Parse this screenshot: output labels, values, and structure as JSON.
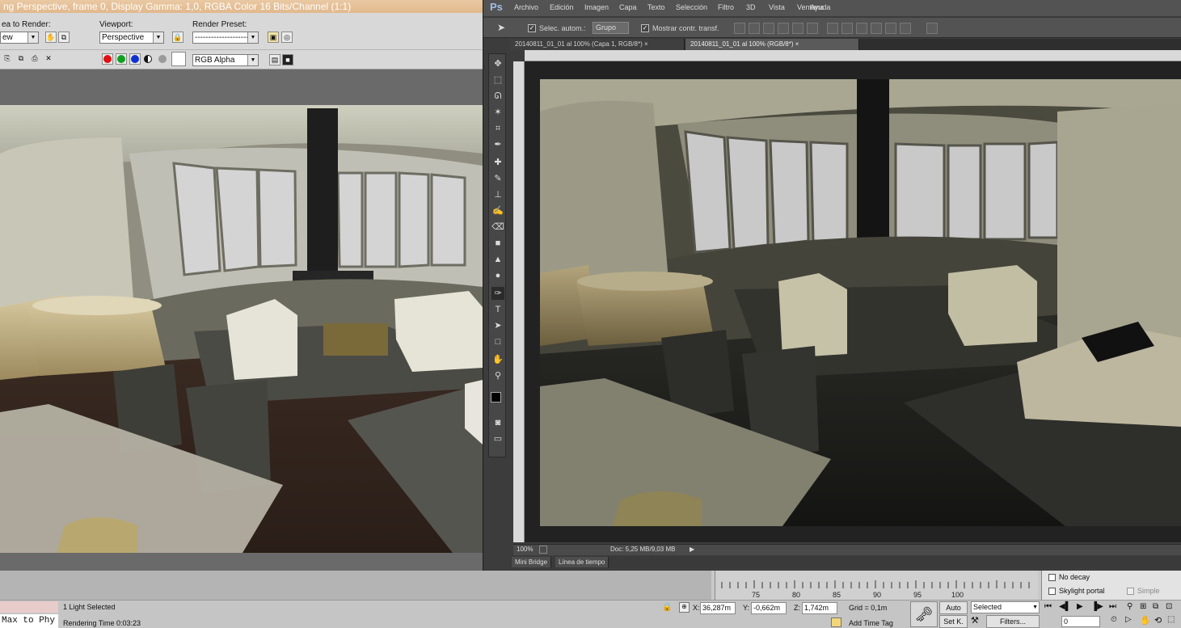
{
  "max": {
    "title": "ng Perspective, frame 0, Display Gamma: 1,0, RGBA Color 16 Bits/Channel (1:1)",
    "area_label": "ea to Render:",
    "area_value": "ew",
    "viewport_label": "Viewport:",
    "viewport_value": "Perspective",
    "preset_label": "Render Preset:",
    "preset_value": "--------------------",
    "channel_value": "RGB Alpha",
    "colors": {
      "red": "#e01010",
      "green": "#10a020",
      "blue": "#1030d0"
    }
  },
  "ps": {
    "logo": "Ps",
    "menu": [
      "Archivo",
      "Edición",
      "Imagen",
      "Capa",
      "Texto",
      "Selección",
      "Filtro",
      "3D",
      "Vista",
      "Ventana",
      "Ayuda"
    ],
    "options": {
      "auto_select_label": "Selec. autom.:",
      "auto_select_value": "Grupo",
      "transform_label": "Mostrar contr. transf."
    },
    "tabs": [
      {
        "label": "20140811_01_01 al 100% (Capa 1, RGB/8*) ×",
        "active": false
      },
      {
        "label": "20140811_01_01 al 100% (RGB/8*) ×",
        "active": true
      }
    ],
    "status": {
      "zoom": "100%",
      "doc": "Doc: 5,25 MB/9,03 MB"
    },
    "bottom_tabs": [
      "Mini Bridge",
      "Línea de tiempo"
    ]
  },
  "trackbar": {
    "ticks": [
      "75",
      "80",
      "85",
      "90",
      "95",
      "100"
    ]
  },
  "right_panel": {
    "no_decay": "No decay",
    "skylight_portal": "Skylight portal",
    "simple": "Simple"
  },
  "status_bar": {
    "script_text": "Max to Phy",
    "selected_text": "1 Light Selected",
    "render_time": "Rendering Time  0:03:23",
    "x_label": "X:",
    "x_value": "36,287m",
    "y_label": "Y:",
    "y_value": "-0,662m",
    "z_label": "Z:",
    "z_value": "1,742m",
    "grid": "Grid = 0,1m",
    "add_time_tag": "Add Time Tag",
    "auto": "Auto",
    "set_k": "Set K.",
    "selected_dropdown": "Selected",
    "filters": "Filters...",
    "frame_value": "0"
  }
}
